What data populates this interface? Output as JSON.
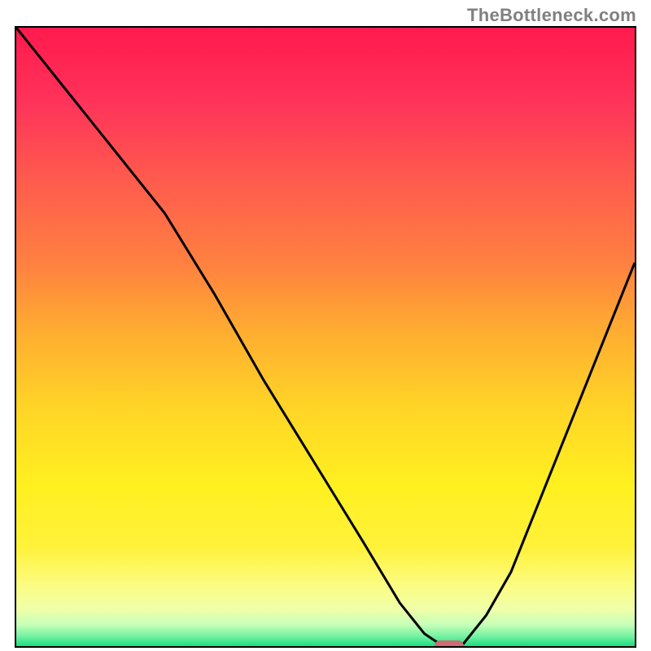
{
  "watermark": "TheBottleneck.com",
  "chart_data": {
    "type": "line",
    "title": "",
    "xlabel": "",
    "ylabel": "",
    "xlim": [
      0,
      100
    ],
    "ylim": [
      0,
      100
    ],
    "series": [
      {
        "name": "curve",
        "x": [
          0,
          8,
          16,
          24,
          32,
          40,
          48,
          56,
          62,
          66,
          69,
          72,
          76,
          80,
          84,
          88,
          92,
          96,
          100
        ],
        "values": [
          100,
          90,
          80,
          70,
          57,
          43,
          30,
          17,
          7,
          2,
          0,
          0,
          5,
          12,
          22,
          32,
          42,
          52,
          62
        ]
      }
    ],
    "marker": {
      "x": 70,
      "y": 0
    },
    "gradient_stops": [
      {
        "pos": 0.0,
        "color": "#ff1a4d"
      },
      {
        "pos": 0.12,
        "color": "#ff335a"
      },
      {
        "pos": 0.25,
        "color": "#ff5c4d"
      },
      {
        "pos": 0.38,
        "color": "#ff8040"
      },
      {
        "pos": 0.5,
        "color": "#ffb030"
      },
      {
        "pos": 0.62,
        "color": "#ffd626"
      },
      {
        "pos": 0.74,
        "color": "#fff020"
      },
      {
        "pos": 0.84,
        "color": "#fff23a"
      },
      {
        "pos": 0.9,
        "color": "#fcfc80"
      },
      {
        "pos": 0.94,
        "color": "#f0ffa8"
      },
      {
        "pos": 0.965,
        "color": "#c8ffb8"
      },
      {
        "pos": 0.985,
        "color": "#70f0a0"
      },
      {
        "pos": 1.0,
        "color": "#18e080"
      }
    ]
  }
}
